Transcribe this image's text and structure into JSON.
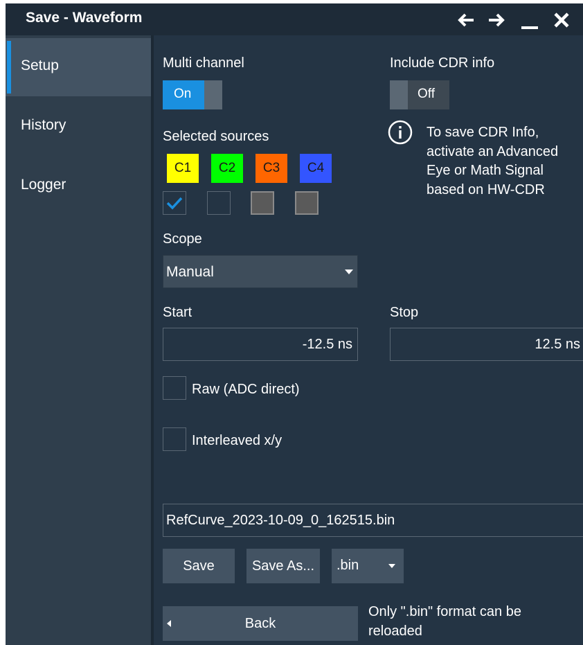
{
  "window": {
    "title": "Save - Waveform"
  },
  "titlebar_icons": [
    "arrow-left-icon",
    "arrow-right-icon",
    "minimize-icon",
    "close-icon"
  ],
  "sidebar": {
    "items": [
      {
        "label": "Setup",
        "active": true
      },
      {
        "label": "History",
        "active": false
      },
      {
        "label": "Logger",
        "active": false
      }
    ]
  },
  "setup": {
    "multi_channel_label": "Multi channel",
    "multi_channel_state": "On",
    "include_cdr_label": "Include CDR info",
    "include_cdr_state": "Off",
    "cdr_info_lines": [
      "To save CDR Info,",
      "activate an Advanced",
      "Eye or Math Signal",
      "based on HW-CDR"
    ],
    "selected_sources_label": "Selected sources",
    "channels": [
      {
        "label": "C1",
        "color": "#ffff00",
        "checked": true
      },
      {
        "label": "C2",
        "color": "#00ff00",
        "checked": false
      },
      {
        "label": "C3",
        "color": "#ff6600",
        "checked": false
      },
      {
        "label": "C4",
        "color": "#3355ff",
        "checked": false
      }
    ],
    "scope_label": "Scope",
    "scope_value": "Manual",
    "start_label": "Start",
    "start_value": "-12.5 ns",
    "stop_label": "Stop",
    "stop_value": "12.5 ns",
    "raw_label": "Raw (ADC direct)",
    "raw_checked": false,
    "interleaved_label": "Interleaved x/y",
    "interleaved_checked": false,
    "filename": "RefCurve_2023-10-09_0_162515.bin",
    "save_label": "Save",
    "save_as_label": "Save As...",
    "format_value": ".bin",
    "back_label": "Back",
    "reload_note_lines": [
      "Only \".bin\" format can be",
      "reloaded"
    ]
  },
  "colors": {
    "accent": "#1a90e0",
    "background": "#243444",
    "sidebar": "#2f3e4c",
    "titlebar": "#1e2b38"
  }
}
